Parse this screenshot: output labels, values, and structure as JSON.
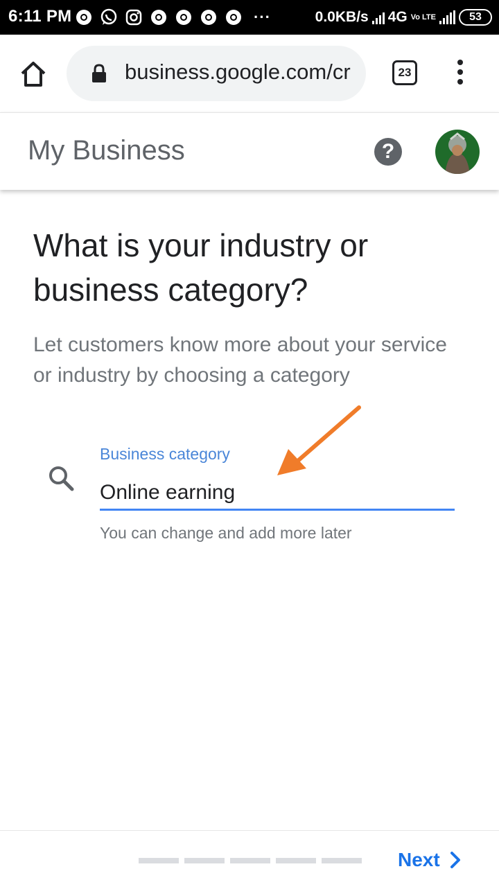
{
  "status_bar": {
    "time": "6:11 PM",
    "notification_icons": [
      "chrome-icon",
      "whatsapp-icon",
      "instagram-icon",
      "chrome-icon",
      "chrome-icon",
      "chrome-icon",
      "chrome-icon"
    ],
    "overflow": "···",
    "network_speed": "0.0KB/s",
    "network_type": "4G",
    "volte_label": "Vo LTE",
    "battery": "53"
  },
  "browser": {
    "url": "business.google.com/create",
    "tab_count": "23"
  },
  "header": {
    "title": "My Business",
    "help_icon": "?"
  },
  "main": {
    "question": "What is your industry or business category?",
    "description": "Let customers know more about your service or industry by choosing a category",
    "field": {
      "label": "Business category",
      "value": "Online earning",
      "helper": "You can change and add more later"
    }
  },
  "footer": {
    "progress_steps": 5,
    "next_label": "Next"
  },
  "colors": {
    "accent": "#4285f4",
    "link": "#1a73e8",
    "annotation_arrow": "#f07c2a"
  }
}
